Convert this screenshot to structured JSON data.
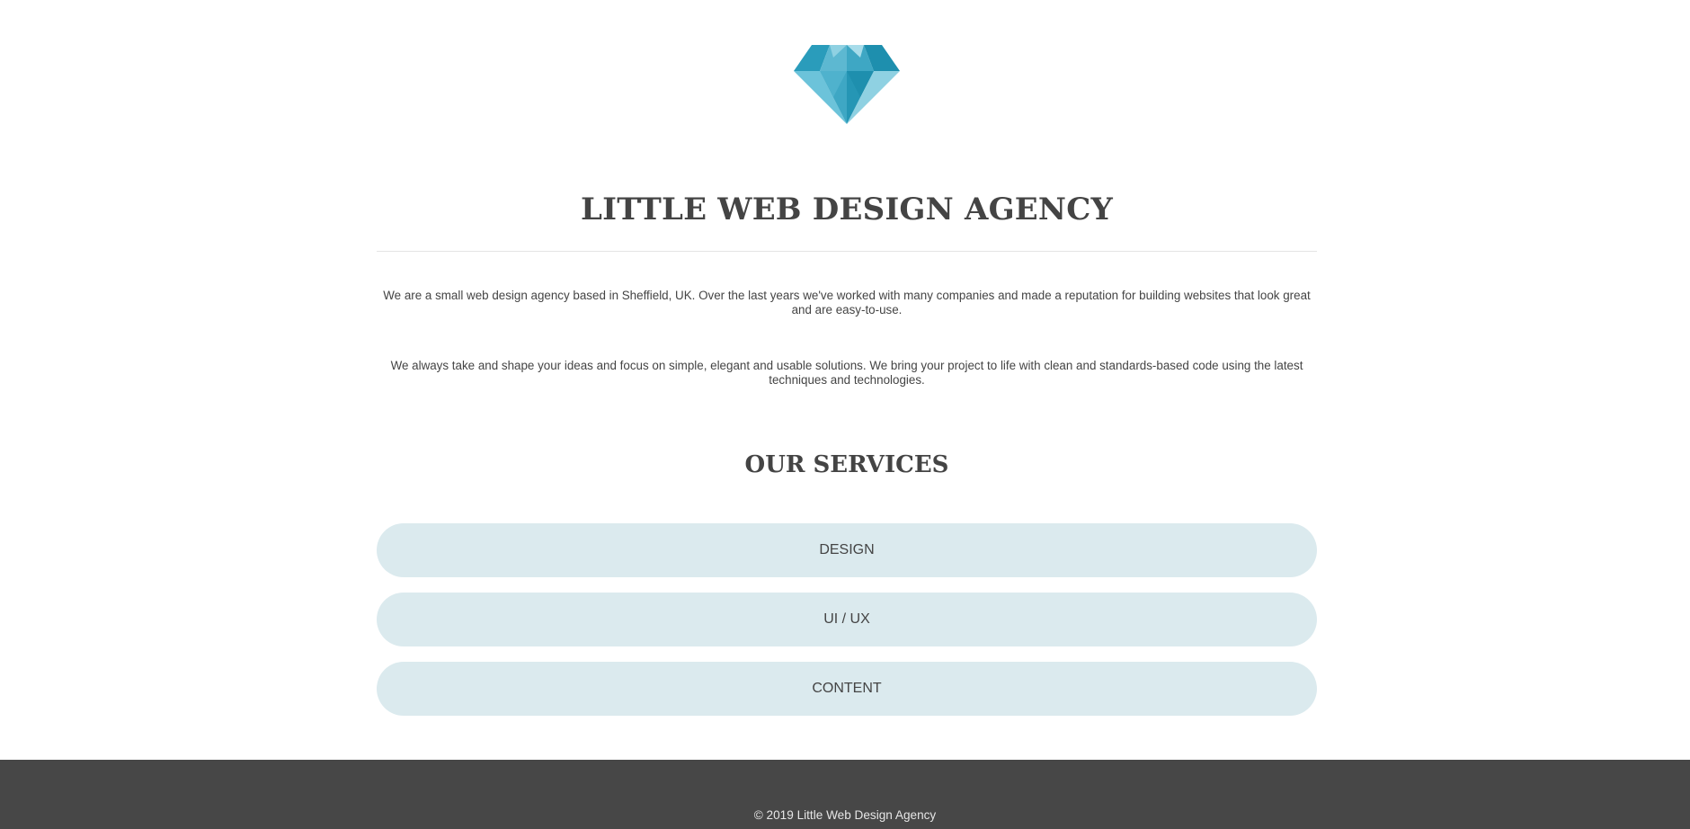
{
  "header": {
    "logo_icon": "diamond-icon",
    "title": "LITTLE WEB DESIGN AGENCY"
  },
  "intro": {
    "paragraph_1": "We are a small web design agency based in Sheffield, UK. Over the last years we've worked with many companies and made a reputation for building websites that look great and are easy-to-use.",
    "paragraph_2": "We always take and shape your ideas and focus on simple, elegant and usable solutions. We bring your project to life with clean and standards-based code using the latest techniques and technologies."
  },
  "services": {
    "heading": "OUR SERVICES",
    "items": [
      {
        "label": "DESIGN"
      },
      {
        "label": "UI / UX"
      },
      {
        "label": "CONTENT"
      }
    ]
  },
  "footer": {
    "copyright": "© 2019 Little Web Design Agency"
  },
  "colors": {
    "text": "#444444",
    "service_bg": "#dbeaee",
    "footer_bg": "#474747",
    "footer_text": "#e6e6e6",
    "logo_dark": "#1e8fae",
    "logo_light": "#8fd1e2"
  }
}
